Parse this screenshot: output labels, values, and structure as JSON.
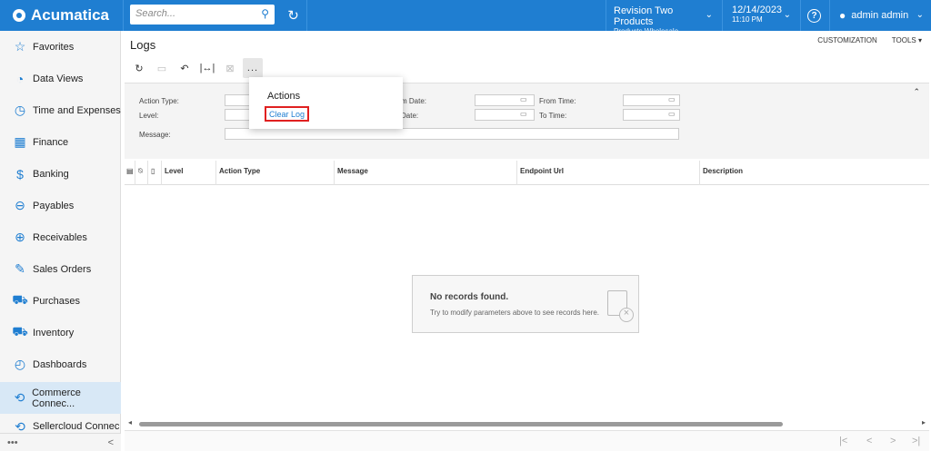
{
  "app": {
    "name": "Acumatica"
  },
  "search": {
    "placeholder": "Search..."
  },
  "company": {
    "branch": "Revision Two Products",
    "company": "Products Wholesale"
  },
  "datetime": {
    "date": "12/14/2023",
    "time": "11:10 PM"
  },
  "user": {
    "name": "admin admin"
  },
  "sidebar": {
    "items": [
      {
        "label": "Favorites",
        "icon": "star-icon"
      },
      {
        "label": "Data Views",
        "icon": "pie-chart-icon"
      },
      {
        "label": "Time and Expenses",
        "icon": "stopwatch-icon"
      },
      {
        "label": "Finance",
        "icon": "calculator-icon"
      },
      {
        "label": "Banking",
        "icon": "dollar-icon"
      },
      {
        "label": "Payables",
        "icon": "minus-circle-icon"
      },
      {
        "label": "Receivables",
        "icon": "plus-circle-icon"
      },
      {
        "label": "Sales Orders",
        "icon": "pencil-square-icon"
      },
      {
        "label": "Purchases",
        "icon": "cart-icon"
      },
      {
        "label": "Inventory",
        "icon": "truck-icon"
      },
      {
        "label": "Dashboards",
        "icon": "gauge-icon"
      },
      {
        "label": "Commerce Connec...",
        "icon": "sync-icon",
        "active": true
      },
      {
        "label": "Sellercloud Connec",
        "icon": "sync-icon"
      }
    ],
    "more": "•••",
    "collapse": "<"
  },
  "page": {
    "title": "Logs",
    "customization": "CUSTOMIZATION",
    "tools": "TOOLS ▾"
  },
  "toolbar": {
    "refresh": "↻",
    "save": "▭",
    "undo": "↶",
    "fit": "|↔|",
    "excel": "⊠",
    "more": "..."
  },
  "filter": {
    "action_type_label": "Action Type:",
    "level_label": "Level:",
    "message_label": "Message:",
    "from_date_label": "m Date:",
    "to_date_label": "Date:",
    "from_time_label": "From Time:",
    "to_time_label": "To Time:"
  },
  "grid": {
    "columns": [
      "Level",
      "Action Type",
      "Message",
      "Endpoint Url",
      "Description"
    ],
    "empty_title": "No records found.",
    "empty_hint": "Try to modify parameters above to see records here."
  },
  "actions_menu": {
    "header": "Actions",
    "items": [
      "Clear Log"
    ]
  },
  "colors": {
    "topbar": "#1f7ed1",
    "highlight_border": "#e02020",
    "link": "#1f7ed1"
  }
}
